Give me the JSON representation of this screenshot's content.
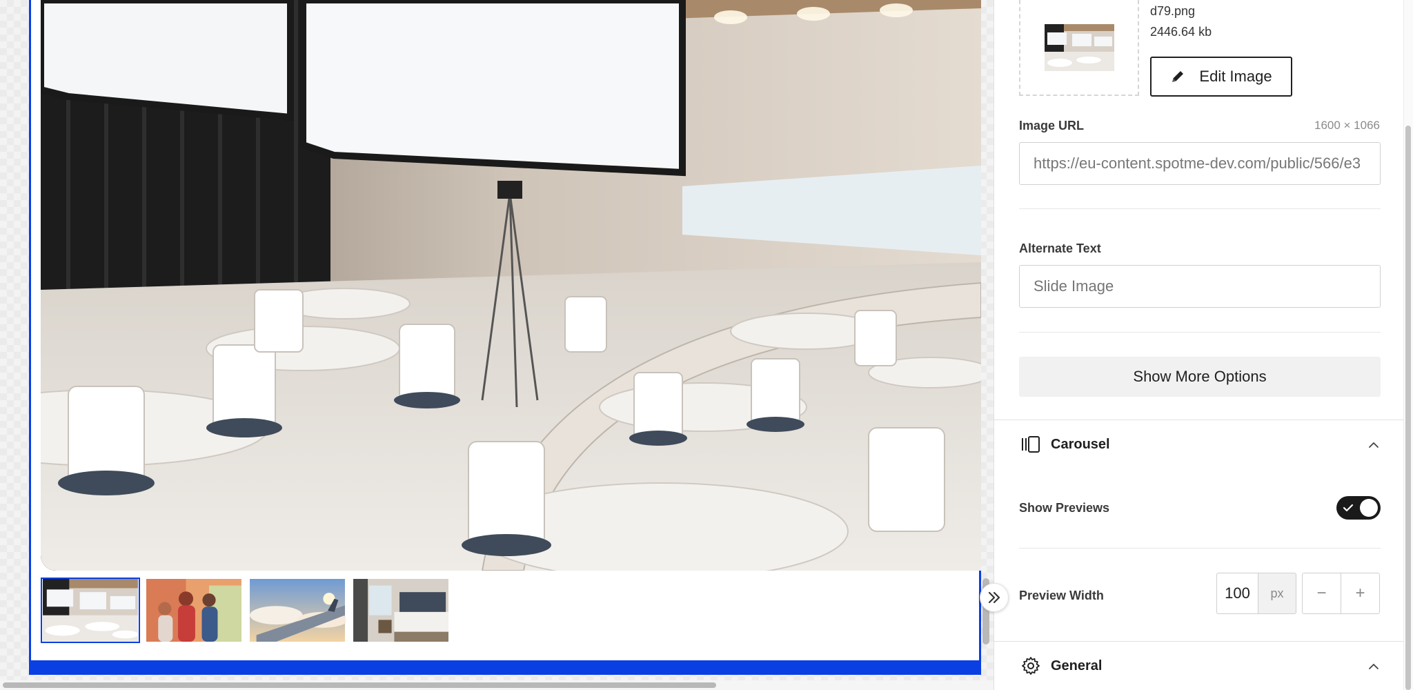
{
  "image_settings": {
    "file_name": "d79.png",
    "file_size": "2446.64 kb",
    "edit_label": "Edit Image",
    "url_label": "Image URL",
    "dimensions": "1600 × 1066",
    "url_value": "https://eu-content.spotme-dev.com/public/566/e3",
    "alt_label": "Alternate Text",
    "alt_placeholder": "Slide Image",
    "show_more_label": "Show More Options"
  },
  "carousel": {
    "title": "Carousel",
    "show_previews_label": "Show Previews",
    "show_previews_on": true,
    "preview_width_label": "Preview Width",
    "preview_width_value": "100",
    "preview_width_unit": "px",
    "minus_symbol": "−",
    "plus_symbol": "+"
  },
  "general": {
    "title": "General"
  },
  "slides": {
    "active_index": 0,
    "thumbnails": [
      "conference-hall",
      "people-meeting",
      "airplane-wing-sky",
      "hotel-room"
    ]
  },
  "colors": {
    "accent": "#0a3fe4",
    "toggle_on": "#1a1a1a"
  }
}
